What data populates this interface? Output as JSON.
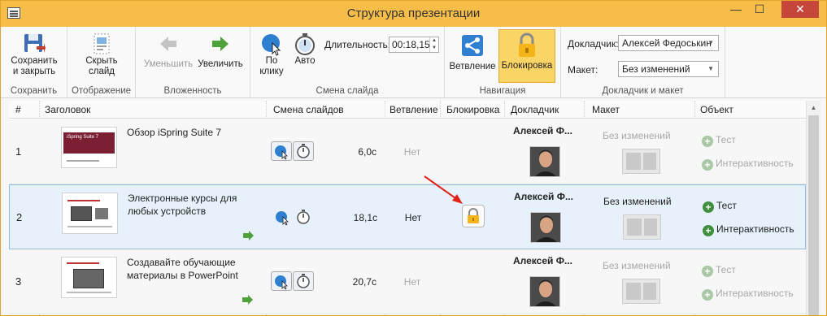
{
  "window": {
    "title": "Структура презентации",
    "minimize_glyph": "—",
    "maximize_glyph": "☐",
    "close_glyph": "✕"
  },
  "ribbon": {
    "save": {
      "label1": "Сохранить",
      "label2": "и закрыть",
      "group": "Сохранить"
    },
    "display": {
      "label1": "Скрыть",
      "label2": "слайд",
      "group": "Отображение"
    },
    "nesting": {
      "decrease": "Уменьшить",
      "increase": "Увеличить",
      "group": "Вложенность"
    },
    "slide_change": {
      "on_click1": "По",
      "on_click2": "клику",
      "auto": "Авто",
      "duration_label": "Длительность:",
      "duration_value": "00:18,15",
      "group": "Смена слайда"
    },
    "navigation": {
      "branch": "Ветвление",
      "lock": "Блокировка",
      "group": "Навигация"
    },
    "speaker_layout": {
      "speaker_label": "Докладчик:",
      "speaker_value": "Алексей Федоськин",
      "layout_label": "Макет:",
      "layout_value": "Без изменений",
      "group": "Докладчик и макет"
    }
  },
  "table": {
    "headers": {
      "num": "#",
      "title": "Заголовок",
      "transition": "Смена слайдов",
      "branching": "Ветвление",
      "locking": "Блокировка",
      "speaker": "Докладчик",
      "layout": "Макет",
      "object": "Объект"
    },
    "rows": [
      {
        "num": "1",
        "title": "Обзор iSpring Suite 7",
        "thumb_caption": "iSpring Suite 7",
        "duration": "6,0с",
        "branching": "Нет",
        "speaker": "Алексей Ф...",
        "layout": "Без изменений",
        "obj_test": "Тест",
        "obj_interactive": "Интерактивность"
      },
      {
        "num": "2",
        "title": "Электронные курсы для любых устройств",
        "duration": "18,1с",
        "branching": "Нет",
        "speaker": "Алексей Ф...",
        "layout": "Без изменений",
        "obj_test": "Тест",
        "obj_interactive": "Интерактивность"
      },
      {
        "num": "3",
        "title": "Создавайте обучающие материалы в PowerPoint",
        "duration": "20,7с",
        "branching": "Нет",
        "speaker": "Алексей Ф...",
        "layout": "Без изменений",
        "obj_test": "Тест",
        "obj_interactive": "Интерактивность"
      }
    ]
  },
  "colors": {
    "titlebar": "#f6bd49",
    "accent_active": "#fbd466",
    "selected_row": "#e6f1fb",
    "green": "#3f8f3d",
    "red_arrow": "#e2231a"
  }
}
